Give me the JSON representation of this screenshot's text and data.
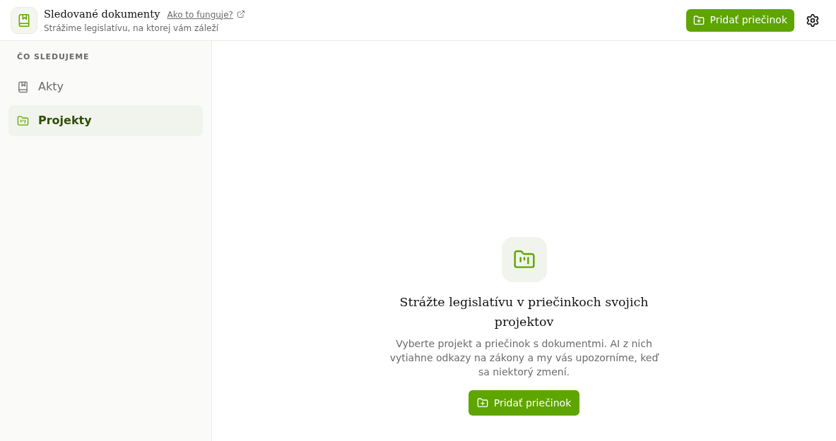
{
  "header": {
    "title": "Sledované dokumenty",
    "help_link": "Ako to funguje?",
    "subtitle": "Strážime legislatívu, na ktorej vám záleží",
    "add_button": "Pridať priečinok"
  },
  "sidebar": {
    "heading": "ČO SLEDUJEME",
    "items": [
      {
        "label": "Akty",
        "kind": "acts",
        "selected": false
      },
      {
        "label": "Projekty",
        "kind": "projects",
        "selected": true
      }
    ]
  },
  "empty_state": {
    "title": "Strážte legislatívu v priečinkoch svojich projektov",
    "description": "Vyberte projekt a priečinok s dokumentmi. AI z nich vytiahne odkazy na zákony a my vás upozorníme, keď sa niektorý zmení.",
    "button": "Pridať priečinok"
  }
}
